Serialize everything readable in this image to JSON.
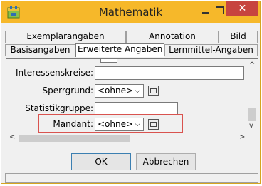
{
  "window": {
    "title": "Mathematik",
    "close_glyph": "✕"
  },
  "tabs": {
    "row1": [
      "Exemplarangaben",
      "Annotation",
      "Bild"
    ],
    "row2": [
      "Basisangaben",
      "Erweiterte Angaben",
      "Lernmittel-Angaben"
    ],
    "active": "Erweiterte Angaben"
  },
  "form": {
    "interessenskreise_label": "Interessenskreise:",
    "interessenskreise_value": "",
    "sperrgrund_label": "Sperrgrund:",
    "sperrgrund_value": "<ohne>",
    "statistikgruppe_label": "Statistikgruppe:",
    "statistikgruppe_value": "",
    "mandant_label": "Mandant:",
    "mandant_value": "<ohne>"
  },
  "buttons": {
    "ok": "OK",
    "cancel": "Abbrechen"
  },
  "icons": {
    "app": "app-icon",
    "dropdown": "chevron-down-icon",
    "edit": "edit-icon"
  },
  "colors": {
    "titlebar": "#f6b82a",
    "close": "#c7443f",
    "highlight": "#d9534f"
  }
}
